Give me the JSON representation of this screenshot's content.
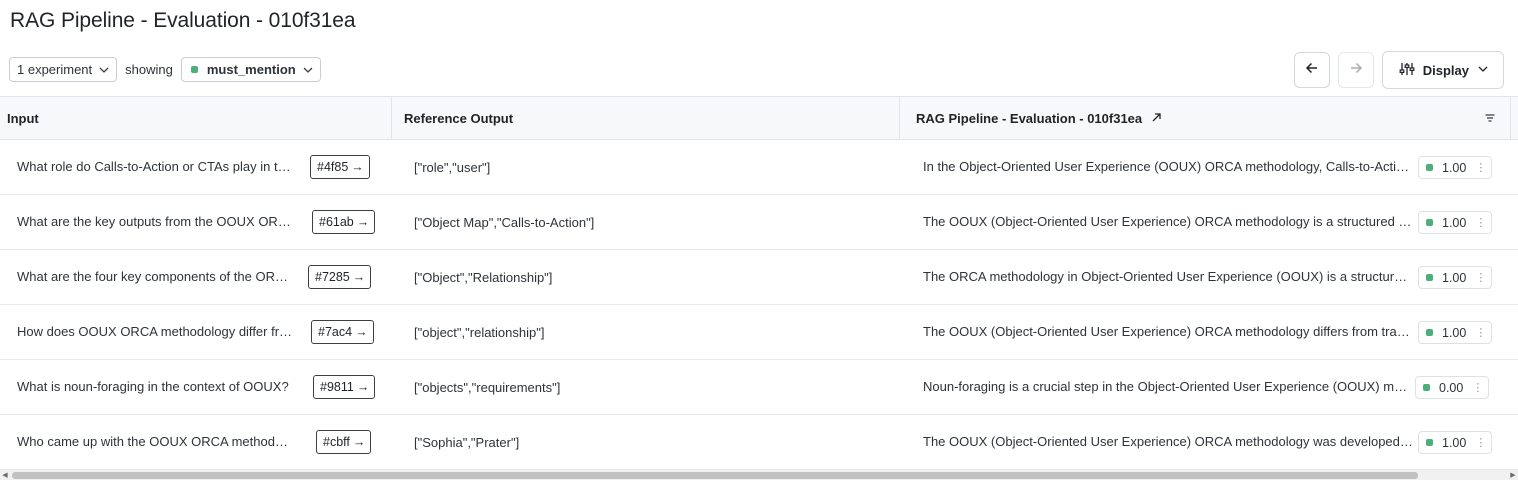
{
  "page": {
    "title": "RAG Pipeline - Evaluation - 010f31ea"
  },
  "toolbar": {
    "experiment_select": "1 experiment",
    "showing_label": "showing",
    "metric_select": "must_mention",
    "display_label": "Display",
    "back_icon": "arrow-left-icon",
    "forward_icon": "arrow-right-icon",
    "display_icon": "sliders-icon"
  },
  "table": {
    "headers": {
      "input": "Input",
      "reference": "Reference Output",
      "experiment": "RAG Pipeline - Evaluation - 010f31ea"
    },
    "rows": [
      {
        "input": "What role do Calls-to-Action or CTAs play in the OOUX ORCA methodology?",
        "id": "#4f85",
        "reference": "[\"role\",\"user\"]",
        "output": "In the Object-Oriented User Experience (OOUX) ORCA methodology, Calls-to-Action play a key role",
        "score": "1.00"
      },
      {
        "input": "What are the key outputs from the OOUX ORCA process?",
        "id": "#61ab",
        "reference": "[\"Object Map\",\"Calls-to-Action\"]",
        "output": "The OOUX (Object-Oriented User Experience) ORCA methodology is a structured approach",
        "score": "1.00"
      },
      {
        "input": "What are the four key components of the ORCA methodology?",
        "id": "#7285",
        "reference": "[\"Object\",\"Relationship\"]",
        "output": "The ORCA methodology in Object-Oriented User Experience (OOUX) is a structured approach",
        "score": "1.00"
      },
      {
        "input": "How does OOUX ORCA methodology differ from other approaches?",
        "id": "#7ac4",
        "reference": "[\"object\",\"relationship\"]",
        "output": "The OOUX (Object-Oriented User Experience) ORCA methodology differs from traditional approaches",
        "score": "1.00"
      },
      {
        "input": "What is noun-foraging in the context of OOUX?",
        "id": "#9811",
        "reference": "[\"objects\",\"requirements\"]",
        "output": "Noun-foraging is a crucial step in the Object-Oriented User Experience (OOUX) methodology",
        "score": "0.00"
      },
      {
        "input": "Who came up with the OOUX ORCA methodology?",
        "id": "#cbff",
        "reference": "[\"Sophia\",\"Prater\"]",
        "output": "The OOUX (Object-Oriented User Experience) ORCA methodology was developed by Sophia Prater",
        "score": "1.00"
      }
    ]
  },
  "colors": {
    "score_dot": "#4caf7a",
    "header_bg": "#f7f8fa",
    "border": "#e1e4e8"
  }
}
